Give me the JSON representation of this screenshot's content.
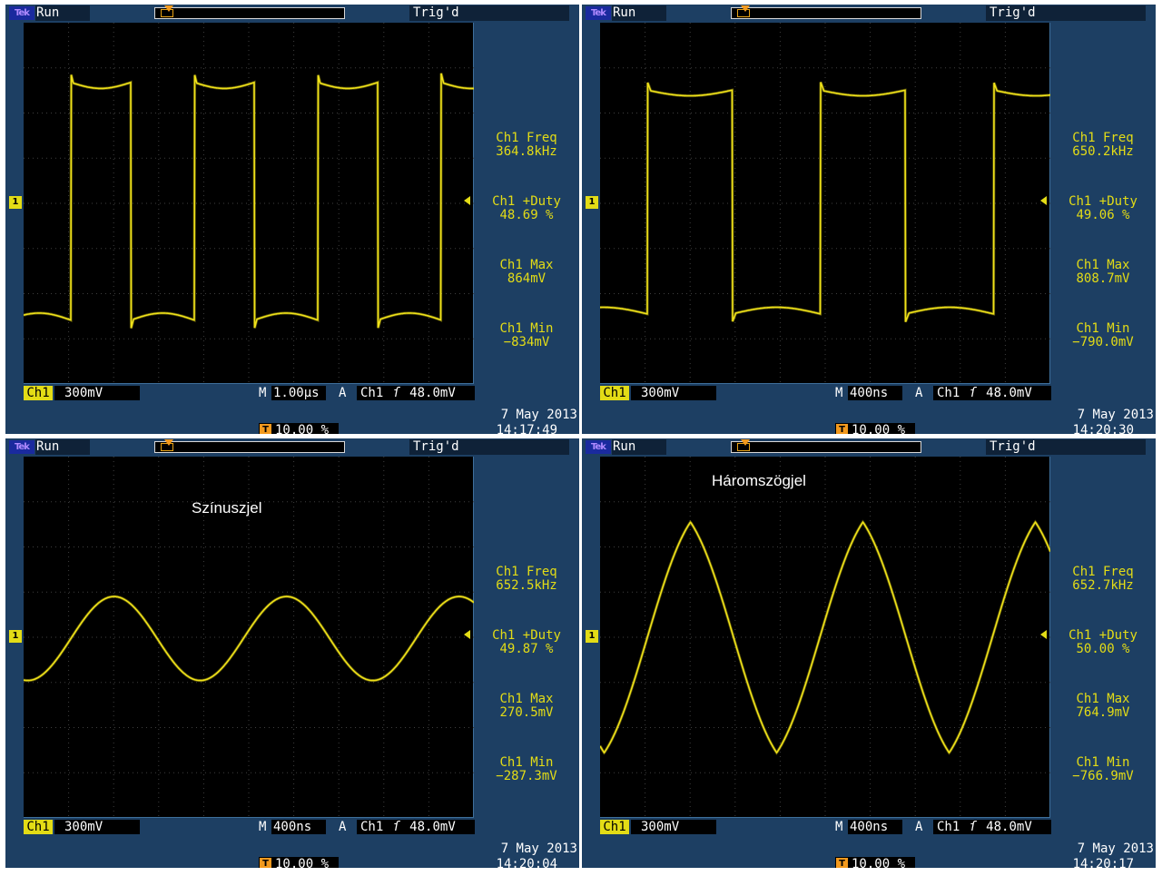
{
  "colors": {
    "trace": "#f0e21a",
    "channel": "#e3dc16",
    "frame": "#1d3f63",
    "grid": "#3f3f3f",
    "trigger": "#f39a1e"
  },
  "panels": [
    {
      "status": "Run",
      "trigger_state": "Trig'd",
      "logo": "Tek",
      "channel_tag": "1",
      "channel_label": "Ch1",
      "volts_div": "300mV",
      "m_label": "M",
      "timebase": "1.00µs",
      "a_label": "A",
      "trigger_source": "Ch1",
      "trigger_slope": "ſ",
      "trigger_level": "48.0mV",
      "position_icon": "T",
      "position": "10.00 %",
      "date": "7 May 2013",
      "time": "14:17:49",
      "annotation": "",
      "measurements": [
        {
          "label": "Ch1 Freq",
          "value": "364.8kHz"
        },
        {
          "label": "Ch1 +Duty",
          "value": "48.69 %"
        },
        {
          "label": "Ch1 Max",
          "value": "864mV"
        },
        {
          "label": "Ch1 Min",
          "value": "−834mV"
        }
      ],
      "waveform": {
        "shape": "square",
        "frequency_khz": 364.8,
        "duty": 0.4869,
        "max_mv": 864,
        "min_mv": -834
      }
    },
    {
      "status": "Run",
      "trigger_state": "Trig'd",
      "logo": "Tek",
      "channel_tag": "1",
      "channel_label": "Ch1",
      "volts_div": "300mV",
      "m_label": "M",
      "timebase": "400ns",
      "a_label": "A",
      "trigger_source": "Ch1",
      "trigger_slope": "ſ",
      "trigger_level": "48.0mV",
      "position_icon": "T",
      "position": "10.00 %",
      "date": "7 May 2013",
      "time": "14:20:30",
      "annotation": "",
      "measurements": [
        {
          "label": "Ch1 Freq",
          "value": "650.2kHz"
        },
        {
          "label": "Ch1 +Duty",
          "value": "49.06 %"
        },
        {
          "label": "Ch1 Max",
          "value": "808.7mV"
        },
        {
          "label": "Ch1 Min",
          "value": "−790.0mV"
        }
      ],
      "waveform": {
        "shape": "square",
        "frequency_khz": 650.2,
        "duty": 0.4906,
        "max_mv": 808.7,
        "min_mv": -790.0
      }
    },
    {
      "status": "Run",
      "trigger_state": "Trig'd",
      "logo": "Tek",
      "channel_tag": "1",
      "channel_label": "Ch1",
      "volts_div": "300mV",
      "m_label": "M",
      "timebase": "400ns",
      "a_label": "A",
      "trigger_source": "Ch1",
      "trigger_slope": "ſ",
      "trigger_level": "48.0mV",
      "position_icon": "T",
      "position": "10.00 %",
      "date": "7 May 2013",
      "time": "14:20:04",
      "annotation": "Színuszjel",
      "measurements": [
        {
          "label": "Ch1 Freq",
          "value": "652.5kHz"
        },
        {
          "label": "Ch1 +Duty",
          "value": "49.87 %"
        },
        {
          "label": "Ch1 Max",
          "value": "270.5mV"
        },
        {
          "label": "Ch1 Min",
          "value": "−287.3mV"
        }
      ],
      "waveform": {
        "shape": "sine",
        "frequency_khz": 652.5,
        "duty": 0.4987,
        "max_mv": 270.5,
        "min_mv": -287.3
      }
    },
    {
      "status": "Run",
      "trigger_state": "Trig'd",
      "logo": "Tek",
      "channel_tag": "1",
      "channel_label": "Ch1",
      "volts_div": "300mV",
      "m_label": "M",
      "timebase": "400ns",
      "a_label": "A",
      "trigger_source": "Ch1",
      "trigger_slope": "ſ",
      "trigger_level": "48.0mV",
      "position_icon": "T",
      "position": "10.00 %",
      "date": "7 May 2013",
      "time": "14:20:17",
      "annotation": "Háromszögjel",
      "measurements": [
        {
          "label": "Ch1 Freq",
          "value": "652.7kHz"
        },
        {
          "label": "Ch1 +Duty",
          "value": "50.00 %"
        },
        {
          "label": "Ch1 Max",
          "value": "764.9mV"
        },
        {
          "label": "Ch1 Min",
          "value": "−766.9mV"
        }
      ],
      "waveform": {
        "shape": "rounded-triangle",
        "frequency_khz": 652.7,
        "duty": 0.5,
        "max_mv": 764.9,
        "min_mv": -766.9
      }
    }
  ]
}
